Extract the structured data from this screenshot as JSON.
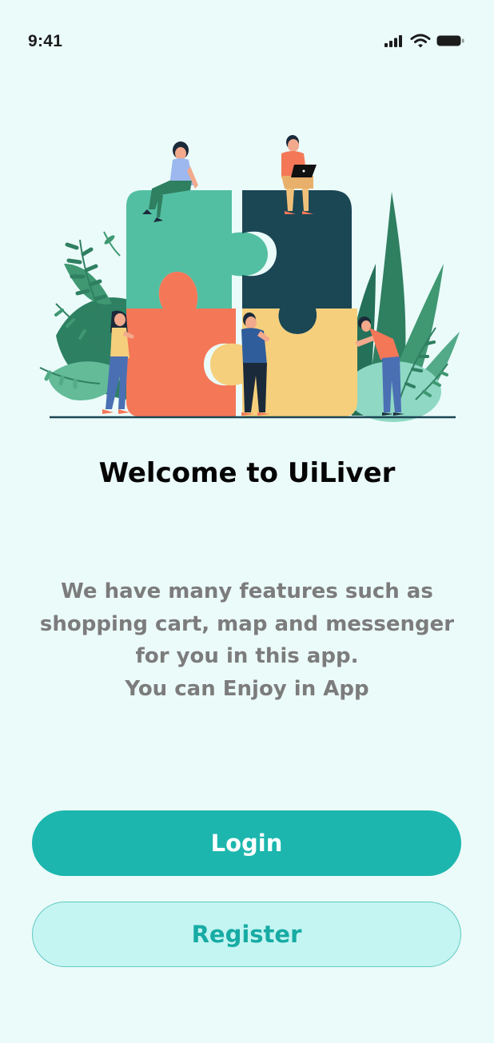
{
  "status_bar": {
    "time": "9:41",
    "icons": [
      "signal-icon",
      "wifi-icon",
      "battery-icon"
    ]
  },
  "hero": {
    "illustration": "team-puzzle-illustration"
  },
  "welcome": {
    "title": "Welcome to UiLiver",
    "description_lines": [
      "We have many features such as",
      "shopping cart, map and messenger",
      "for you in this app.",
      "You can Enjoy in App"
    ]
  },
  "actions": {
    "login_label": "Login",
    "register_label": "Register"
  },
  "colors": {
    "background": "#ebfbf9",
    "primary": "#1cb6ae",
    "secondary_bg": "#c4f5f2",
    "puzzle_green": "#53bfa2",
    "puzzle_navy": "#1b4654",
    "puzzle_coral": "#f47758",
    "puzzle_yellow": "#f6cf7c"
  }
}
